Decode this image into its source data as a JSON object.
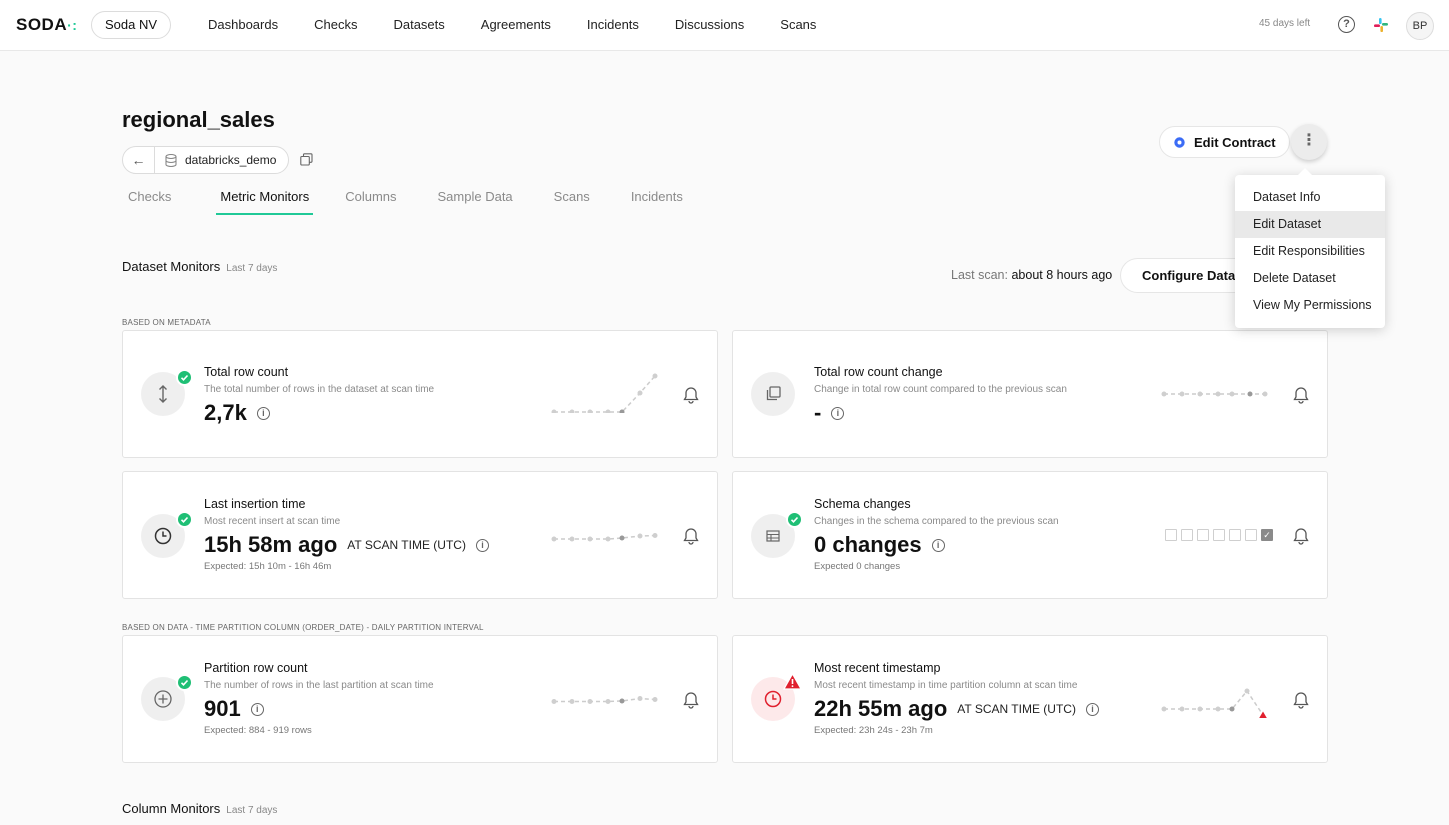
{
  "app": {
    "logo": "SODA",
    "org": "Soda NV",
    "trial": "45 days left",
    "avatar": "BP"
  },
  "nav": [
    "Dashboards",
    "Checks",
    "Datasets",
    "Agreements",
    "Incidents",
    "Discussions",
    "Scans"
  ],
  "header": {
    "title": "regional_sales",
    "datasource": "databricks_demo",
    "edit_contract": "Edit Contract"
  },
  "tabs": [
    "Checks",
    "Metric Monitors",
    "Columns",
    "Sample Data",
    "Scans",
    "Incidents"
  ],
  "active_tab": "Metric Monitors",
  "menu": [
    "Dataset Info",
    "Edit Dataset",
    "Edit Responsibilities",
    "Delete Dataset",
    "View My Permissions"
  ],
  "menu_hover": "Edit Dataset",
  "section": {
    "title": "Dataset Monitors",
    "subtitle": "Last 7 days",
    "last_scan_label": "Last scan:",
    "last_scan_value": "about 8 hours ago",
    "configure": "Configure Datasets",
    "group_metadata": "BASED ON METADATA",
    "group_data": "BASED ON DATA - TIME PARTITION COLUMN (ORDER_DATE) - DAILY PARTITION INTERVAL"
  },
  "cards": [
    {
      "title": "Total row count",
      "desc": "The total number of rows in the dataset at scan time",
      "value": "2,7k",
      "unit": "",
      "expected": "",
      "icon": "arrows-vertical-icon",
      "status": "ok"
    },
    {
      "title": "Total row count change",
      "desc": "Change in total row count compared to the previous scan",
      "value": "-",
      "unit": "",
      "expected": "",
      "icon": "copy-stack-icon",
      "status": "none"
    },
    {
      "title": "Last insertion time",
      "desc": "Most recent insert at scan time",
      "value": "15h 58m ago",
      "unit": "AT SCAN TIME (UTC)",
      "expected": "Expected: 15h 10m - 16h 46m",
      "icon": "clock-icon",
      "status": "ok"
    },
    {
      "title": "Schema changes",
      "desc": "Changes in the schema compared to the previous scan",
      "value": "0 changes",
      "unit": "",
      "expected": "Expected 0 changes",
      "icon": "table-icon",
      "status": "ok"
    },
    {
      "title": "Partition row count",
      "desc": "The number of rows in the last partition at scan time",
      "value": "901",
      "unit": "",
      "expected": "Expected: 884 - 919 rows",
      "icon": "plus-circle-icon",
      "status": "ok"
    },
    {
      "title": "Most recent timestamp",
      "desc": "Most recent timestamp in time partition column at scan time",
      "value": "22h 55m ago",
      "unit": "AT SCAN TIME (UTC)",
      "expected": "Expected: 23h 24s - 23h 7m",
      "icon": "clock-icon",
      "status": "alert"
    }
  ],
  "column_section": {
    "title": "Column Monitors",
    "subtitle": "Last 7 days"
  },
  "colors": {
    "accent": "#20c997",
    "ok": "#1fbf75",
    "alert": "#e0202e",
    "contract": "#3b6cf6"
  }
}
